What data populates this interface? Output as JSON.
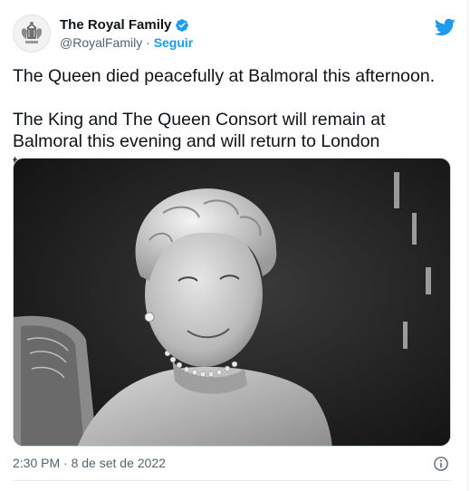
{
  "account": {
    "name": "The Royal Family",
    "handle": "@RoyalFamily",
    "separator": " · ",
    "follow_label": "Seguir"
  },
  "tweet": {
    "paragraphs": [
      "The Queen died peacefully at Balmoral this afternoon.",
      "The King and The Queen Consort will remain at Balmoral this evening and will return to London tomorrow."
    ],
    "timestamp": "2:30 PM · 8 de set de 2022"
  },
  "colors": {
    "accent": "#1d9bf0",
    "text": "#0f1419",
    "secondary": "#536471"
  },
  "icons": {
    "verified": "verified-badge-icon",
    "brand": "twitter-bird-icon",
    "info": "info-icon",
    "avatar": "royal-coat-of-arms"
  }
}
